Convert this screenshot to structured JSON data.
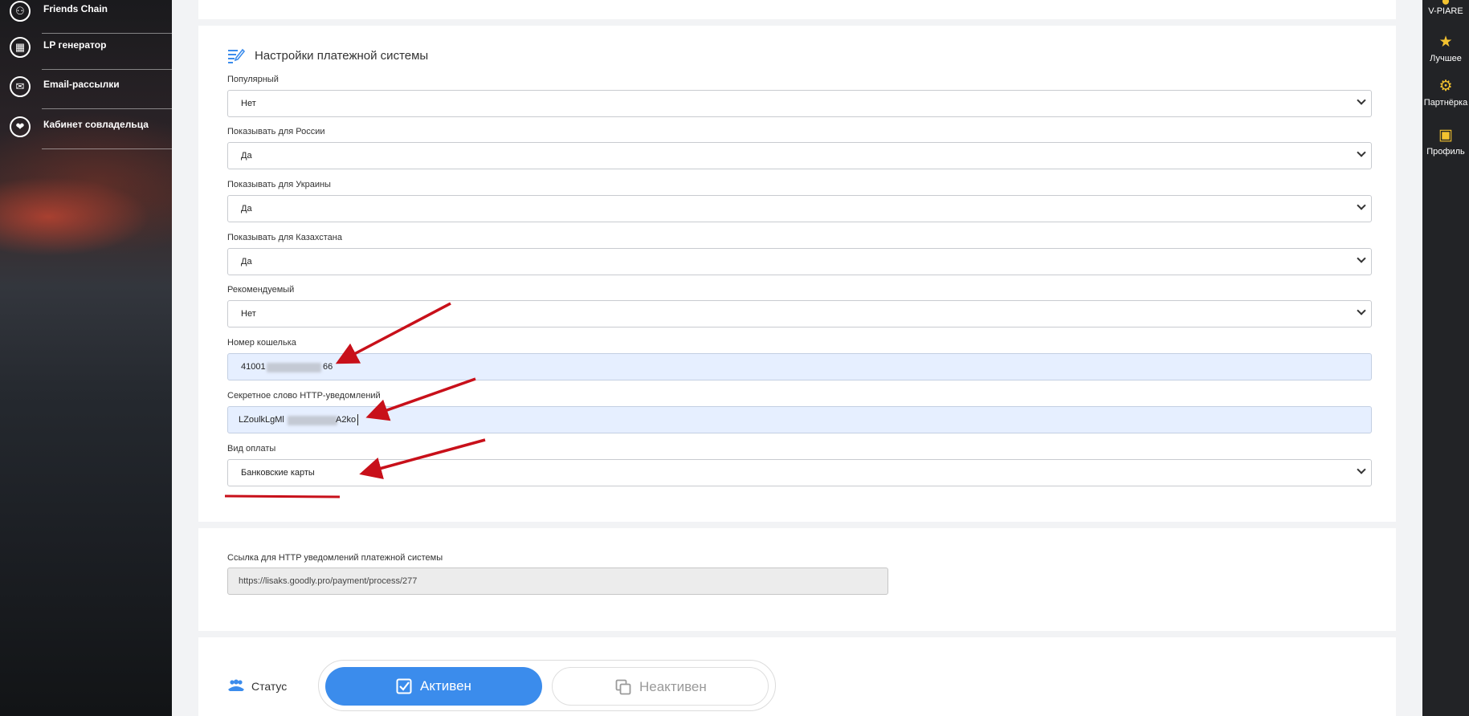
{
  "sidebar": {
    "items": [
      {
        "label": "Friends Chain",
        "icon": "friends-icon"
      },
      {
        "label": "LP генератор",
        "icon": "lp-generator-icon"
      },
      {
        "label": "Email-рассылки",
        "icon": "mail-icon"
      },
      {
        "label": "Кабинет совладельца",
        "icon": "handshake-icon"
      }
    ]
  },
  "rightbar": {
    "items": [
      {
        "label": "V-PIARE",
        "icon": "v-piare-icon"
      },
      {
        "label": "Лучшее",
        "icon": "best-icon"
      },
      {
        "label": "Партнёрка",
        "icon": "partner-icon"
      },
      {
        "label": "Профиль",
        "icon": "profile-icon"
      }
    ]
  },
  "settings": {
    "title": "Настройки платежной системы",
    "fields": [
      {
        "label": "Популярный",
        "value": "Нет"
      },
      {
        "label": "Показывать для России",
        "value": "Да"
      },
      {
        "label": "Показывать для Украины",
        "value": "Да"
      },
      {
        "label": "Показывать для Казахстана",
        "value": "Да"
      },
      {
        "label": "Рекомендуемый",
        "value": "Нет"
      }
    ],
    "wallet": {
      "label": "Номер кошелька",
      "value_start": "41001",
      "value_end": "66"
    },
    "secret": {
      "label": "Секретное слово HTTP-уведомлений",
      "value_start": "LZoulkLgMl",
      "value_end": "A2ko"
    },
    "payment_type": {
      "label": "Вид оплаты",
      "value": "Банковские карты"
    }
  },
  "link": {
    "label": "Ссылка для HTTP уведомлений платежной системы",
    "value": "https://lisaks.goodly.pro/payment/process/277"
  },
  "status": {
    "label": "Статус",
    "active_label": "Активен",
    "inactive_label": "Неактивен"
  },
  "colors": {
    "accent": "#3b8cec",
    "annotation_red": "#c8101a",
    "input_blue": "#e6efff"
  }
}
